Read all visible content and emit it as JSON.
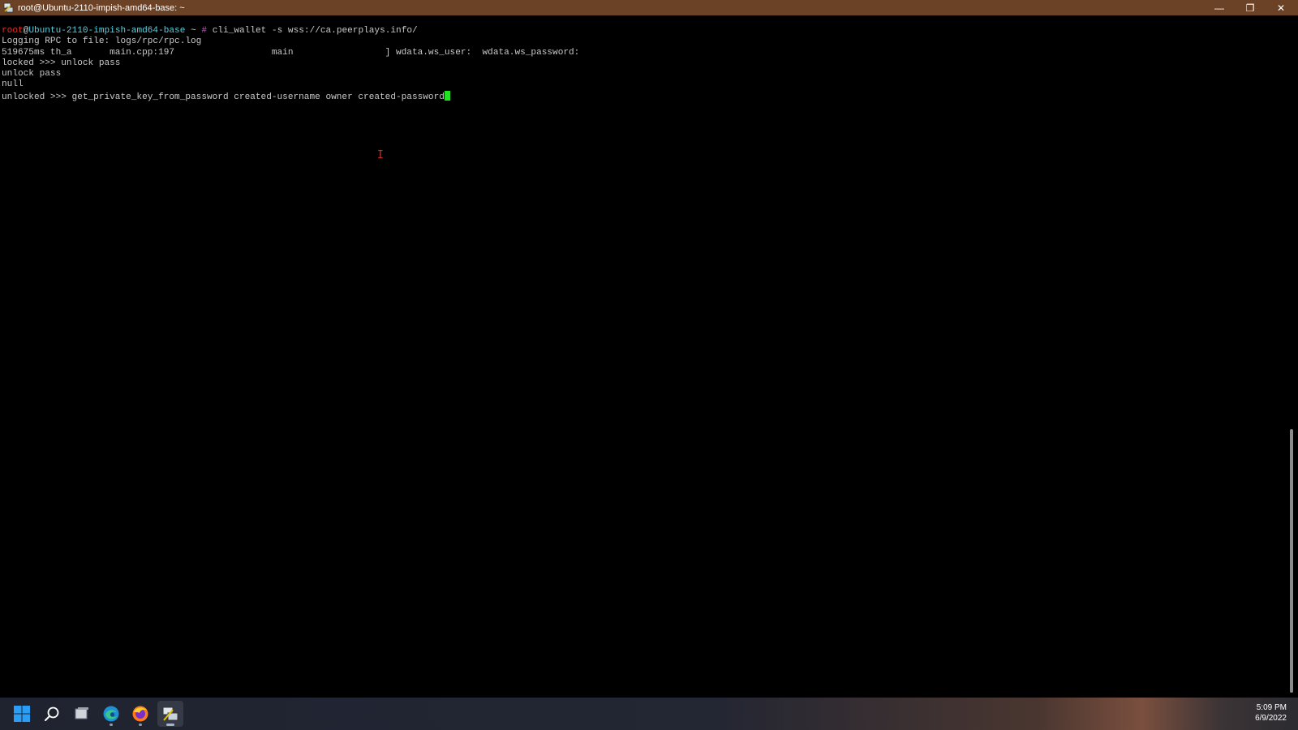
{
  "window": {
    "title": "root@Ubuntu-2110-impish-amd64-base: ~",
    "controls": {
      "minimize": "—",
      "maximize": "❐",
      "close": "✕"
    }
  },
  "terminal": {
    "prompt_user": "root",
    "prompt_at": "@",
    "prompt_host": "Ubuntu-2110-impish-amd64-base",
    "prompt_path": " ~",
    "prompt_symbol": " #",
    "command1": " cli_wallet -s wss://ca.peerplays.info/",
    "line2": "Logging RPC to file: logs/rpc/rpc.log",
    "line3": "519675ms th_a       main.cpp:197                  main                 ] wdata.ws_user:  wdata.ws_password:",
    "line4": "locked >>> unlock pass",
    "line5": "unlock pass",
    "line6": "null",
    "line7": "unlocked >>> get_private_key_from_password created-username owner created-password",
    "cursor_color": "#22e022"
  },
  "taskbar": {
    "icons": [
      "windows-start-icon",
      "search-icon",
      "task-view-icon",
      "edge-icon",
      "firefox-icon",
      "putty-icon"
    ],
    "time": "5:09 PM",
    "date": "6/9/2022"
  }
}
